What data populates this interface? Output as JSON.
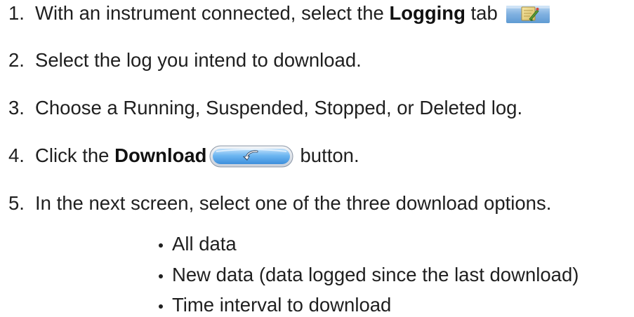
{
  "steps": [
    {
      "number": "1.",
      "before": "With an instrument connected, select the",
      "bold": "Logging",
      "after": "tab",
      "icon": "logging-tab-icon"
    },
    {
      "number": "2.",
      "text": "Select the log you intend to download."
    },
    {
      "number": "3.",
      "text": "Choose a Running, Suspended, Stopped, or Deleted log."
    },
    {
      "number": "4.",
      "before": "Click the",
      "bold": "Download",
      "after": "button.",
      "icon": "download-arrow-icon"
    },
    {
      "number": "5.",
      "text": "In the next screen, select one of the three download options."
    }
  ],
  "options": [
    "All data",
    "New data (data logged since the last download)",
    "Time interval to download"
  ],
  "colors": {
    "text": "#1f1f1f",
    "tab_icon_blue": "#6fa6da",
    "tab_icon_yellow": "#e7d28a",
    "tab_icon_green": "#4a8a32",
    "button_blue": "#4c9ee6",
    "button_border": "#8a96a6"
  }
}
